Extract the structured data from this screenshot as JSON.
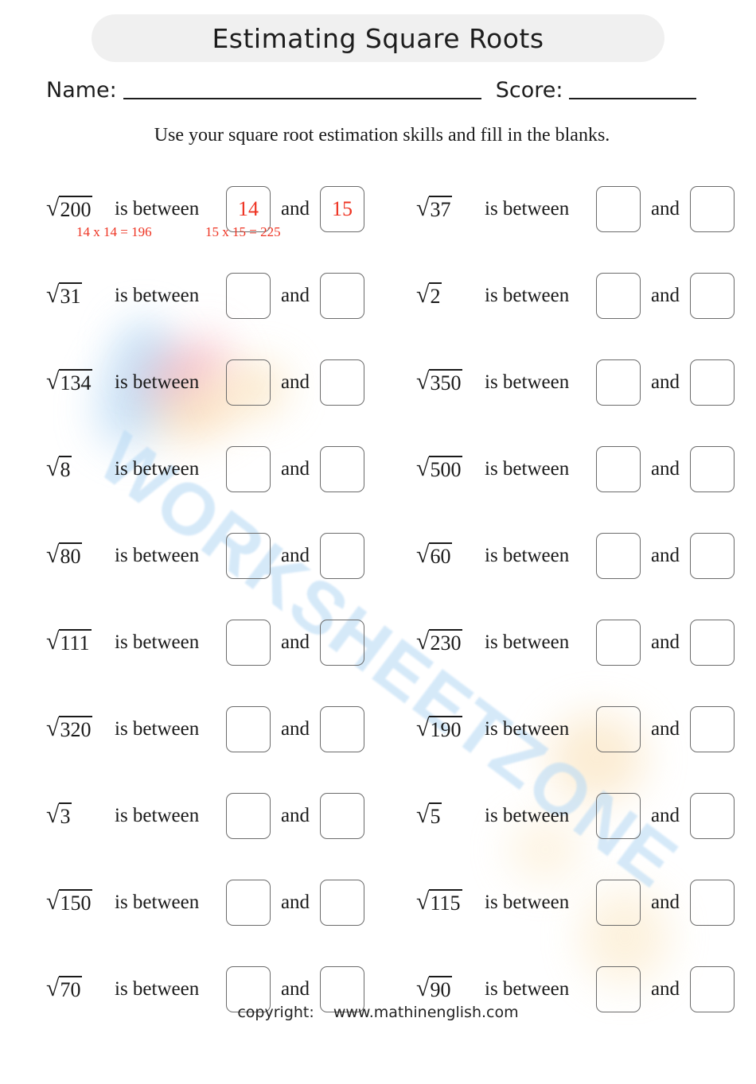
{
  "header": {
    "title": "Estimating Square Roots",
    "name_label": "Name:",
    "score_label": "Score:"
  },
  "instruction": "Use your square root estimation skills and fill in the blanks.",
  "labels": {
    "is_between": "is between",
    "and": "and",
    "radical_sign": "√"
  },
  "colors": {
    "answer_red": "#ee3322",
    "banner_gray": "#f0f0f0",
    "box_border": "#6b6b6b",
    "watermark_blue": "#bcdcf5"
  },
  "watermark": {
    "text": "WORKSHEETZONE"
  },
  "problems": [
    {
      "radicand": "200",
      "lower": "14",
      "upper": "15",
      "hint_lower": "14 x 14 = 196",
      "hint_upper": "15 x 15 = 225"
    },
    {
      "radicand": "37",
      "lower": "",
      "upper": ""
    },
    {
      "radicand": "31",
      "lower": "",
      "upper": ""
    },
    {
      "radicand": "2",
      "lower": "",
      "upper": ""
    },
    {
      "radicand": "134",
      "lower": "",
      "upper": ""
    },
    {
      "radicand": "350",
      "lower": "",
      "upper": ""
    },
    {
      "radicand": "8",
      "lower": "",
      "upper": ""
    },
    {
      "radicand": "500",
      "lower": "",
      "upper": ""
    },
    {
      "radicand": "80",
      "lower": "",
      "upper": ""
    },
    {
      "radicand": "60",
      "lower": "",
      "upper": ""
    },
    {
      "radicand": "111",
      "lower": "",
      "upper": ""
    },
    {
      "radicand": "230",
      "lower": "",
      "upper": ""
    },
    {
      "radicand": "320",
      "lower": "",
      "upper": ""
    },
    {
      "radicand": "190",
      "lower": "",
      "upper": ""
    },
    {
      "radicand": "3",
      "lower": "",
      "upper": ""
    },
    {
      "radicand": "5",
      "lower": "",
      "upper": ""
    },
    {
      "radicand": "150",
      "lower": "",
      "upper": ""
    },
    {
      "radicand": "115",
      "lower": "",
      "upper": ""
    },
    {
      "radicand": "70",
      "lower": "",
      "upper": ""
    },
    {
      "radicand": "90",
      "lower": "",
      "upper": ""
    }
  ],
  "footer": {
    "copyright_label": "copyright:",
    "website": "www.mathinenglish.com"
  }
}
